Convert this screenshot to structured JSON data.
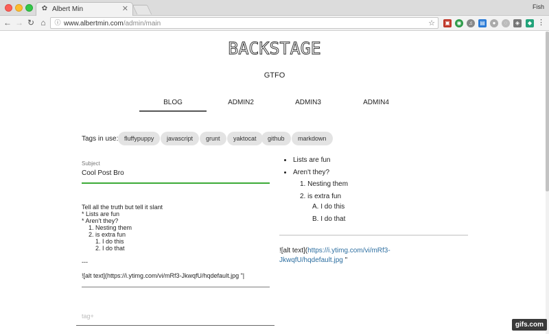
{
  "browser": {
    "tab_title": "Albert Min",
    "profile_name": "Fish",
    "url_host": "www.albertmin.com",
    "url_path": "/admin/main"
  },
  "site": {
    "logo_text": "BACKSTAGE",
    "subtitle": "GTFO",
    "nav": [
      "BLOG",
      "ADMIN2",
      "ADMIN3",
      "ADMIN4"
    ],
    "active_nav": "BLOG"
  },
  "editor": {
    "tags_label": "Tags in use:",
    "tags": [
      "fluffypuppy",
      "javascript",
      "grunt",
      "yaktocat",
      "github",
      "markdown"
    ],
    "subject_label": "Subject",
    "subject_value": "Cool Post Bro",
    "body": "Tell all the truth but tell it slant\n* Lists are fun\n* Aren't they?\n    1. Nesting them\n    2. is extra fun\n        1. I do this\n        2. I do that\n\n---\n\n![alt text](https://i.ytimg.com/vi/mRf3-JkwqfU/hqdefault.jpg \"|",
    "tag_placeholder": "tag+"
  },
  "preview": {
    "bullets": [
      "Lists are fun",
      "Aren't they?"
    ],
    "numbered": [
      "1. Nesting them",
      "2. is extra fun"
    ],
    "sub_numbered": [
      "A. I do this",
      "B. I do that"
    ],
    "image_prefix": "![alt text](",
    "image_link": "https://i.ytimg.com/vi/mRf3-JkwqfU/hqdefault.jpg",
    "image_suffix": " \""
  },
  "watermark": "gifs.com",
  "colors": {
    "subject_underline": "#3aaa35",
    "link": "#2c6ea0"
  }
}
